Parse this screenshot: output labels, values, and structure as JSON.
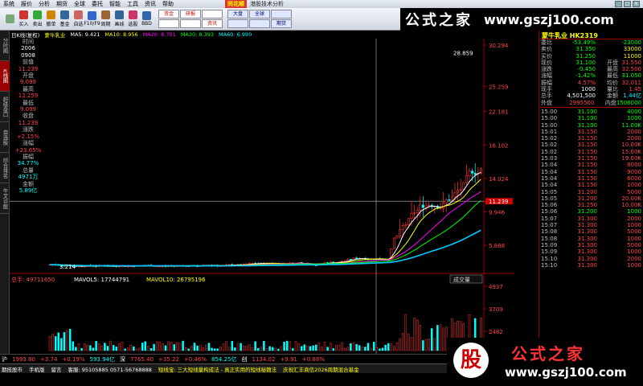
{
  "menu": {
    "items": [
      "系统",
      "报价",
      "分析",
      "期货",
      "全球",
      "委托",
      "智能",
      "工具",
      "资讯",
      "帮助"
    ]
  },
  "app": {
    "logo": "同花顺",
    "title": "港股技术分析"
  },
  "toolbar": {
    "buttons": [
      "",
      "买入",
      "卖出",
      "撤单",
      "基金",
      "自选",
      "F10/F9",
      "周期",
      "画线",
      "选股",
      "BBD"
    ],
    "grp1": [
      "资金",
      "研报",
      "",
      "",
      "",
      "资讯"
    ],
    "grp2": [
      "大盘",
      "全球",
      "",
      "",
      "",
      "期货"
    ]
  },
  "watermark": {
    "cn": "公式之家",
    "url": "www.gszj100.com"
  },
  "left_tabs": [
    "分时图",
    "K线图",
    "超级盘口",
    "自选股",
    "综合排名",
    "牛叉诊股"
  ],
  "chart_header": {
    "period": "日K线(复权)",
    "name": "蒙牛乳业",
    "ma5": "MA5: 9.421",
    "ma10": "MA10: 8.956",
    "ma20": "MA20: 8.701",
    "ma30": "MA30: 8.393",
    "ma60": "MA60: 6.990"
  },
  "info": {
    "time_label": "时间",
    "date_y": "2006",
    "date_md": "0908",
    "prev_label": "前值",
    "prev": "11.239",
    "open_label": "开盘",
    "open": "9.099",
    "high_label": "最高",
    "high": "12.259",
    "low_label": "最低",
    "low": "9.099",
    "close_label": "收盘",
    "close": "11.239",
    "chg_label": "涨跌",
    "chg": "+2.15%",
    "pct_label": "涨幅",
    "pct": "+23.65%",
    "amp_label": "振幅",
    "amp": "34.77%",
    "vol_label": "总量",
    "vol": "4971万",
    "amt_label": "金额",
    "amt": "5.89亿"
  },
  "axis": {
    "prices": [
      "30.294",
      "25.259",
      "22.181",
      "18.102",
      "14.024",
      "11.239",
      "9.946",
      "5.868"
    ],
    "max_mark": "28.859",
    "min_mark": "3.214",
    "vol_ticks": [
      "4937",
      "3709",
      "2482"
    ],
    "vol_sel": "成交量"
  },
  "vol_header": {
    "label": "总手: 49711650",
    "ma5": "MAVOL5: 17744791",
    "ma10": "MAVOL10: 26795196"
  },
  "quote": {
    "title": "蒙牛乳业 HK2319",
    "rows": [
      {
        "l": "委比",
        "m": "-53.49%",
        "r": "",
        "rv": "-23000",
        "mc": "green",
        "rc": "green"
      },
      {
        "l": "卖价",
        "m": "31.350",
        "r": "",
        "rv": "33000",
        "mc": "green",
        "rc": "yel"
      },
      {
        "l": "买价",
        "m": "31.250",
        "r": "",
        "rv": "11000",
        "mc": "green",
        "rc": "yel"
      },
      {
        "l": "现价",
        "m": "31.100",
        "r": "开盘",
        "rv": "31.550",
        "mc": "green",
        "rc": "red"
      },
      {
        "l": "涨跌",
        "m": "-0.450",
        "r": "最高",
        "rv": "32.500",
        "mc": "green",
        "rc": "red"
      },
      {
        "l": "涨幅",
        "m": "-1.42%",
        "r": "最低",
        "rv": "31.050",
        "mc": "green",
        "rc": "green"
      },
      {
        "l": "振幅",
        "m": "4.57%",
        "r": "均价",
        "rv": "32.011",
        "mc": "red",
        "rc": "red"
      },
      {
        "l": "现手",
        "m": "1000",
        "r": "量比",
        "rv": "1.45",
        "mc": "wht",
        "rc": "red"
      },
      {
        "l": "总手",
        "m": "4,501,500",
        "r": "金额",
        "rv": "1.44亿",
        "mc": "wht",
        "rc": "cyan"
      },
      {
        "l": "外盘",
        "m": "2995500",
        "r": "内盘",
        "rv": "1506000",
        "mc": "red",
        "rc": "green"
      }
    ],
    "ticks": [
      {
        "t": "15:00",
        "p": "31.100",
        "v": "4000",
        "c": "green"
      },
      {
        "t": "15:00",
        "p": "31.100",
        "v": "1000",
        "c": "green"
      },
      {
        "t": "15:00",
        "p": "31.100",
        "v": "11.00K",
        "c": "green"
      },
      {
        "t": "15:01",
        "p": "31.150",
        "v": "2000",
        "c": "red"
      },
      {
        "t": "15:02",
        "p": "31.150",
        "v": "2000",
        "c": "red"
      },
      {
        "t": "15:02",
        "p": "31.150",
        "v": "10.00K",
        "c": "red"
      },
      {
        "t": "15:02",
        "p": "31.150",
        "v": "15.00K",
        "c": "red"
      },
      {
        "t": "15:03",
        "p": "31.150",
        "v": "19.00K",
        "c": "red"
      },
      {
        "t": "15:04",
        "p": "31.150",
        "v": "8000",
        "c": "red"
      },
      {
        "t": "15:04",
        "p": "31.150",
        "v": "9000",
        "c": "red"
      },
      {
        "t": "15:04",
        "p": "31.150",
        "v": "6000",
        "c": "red"
      },
      {
        "t": "15:04",
        "p": "31.150",
        "v": "1000",
        "c": "red"
      },
      {
        "t": "15:05",
        "p": "31.200",
        "v": "5000",
        "c": "red"
      },
      {
        "t": "15:05",
        "p": "31.200",
        "v": "20.00K",
        "c": "red"
      },
      {
        "t": "15:06",
        "p": "31.250",
        "v": "10.00K",
        "c": "red"
      },
      {
        "t": "15:06",
        "p": "31.200",
        "v": "1000",
        "c": "green"
      },
      {
        "t": "15:07",
        "p": "31.300",
        "v": "2000",
        "c": "red"
      },
      {
        "t": "15:07",
        "p": "31.300",
        "v": "1000",
        "c": "red"
      },
      {
        "t": "15:08",
        "p": "31.300",
        "v": "5000",
        "c": "red"
      },
      {
        "t": "15:08",
        "p": "31.300",
        "v": "1000",
        "c": "red"
      },
      {
        "t": "15:09",
        "p": "31.300",
        "v": "5000",
        "c": "red"
      },
      {
        "t": "15:09",
        "p": "31.300",
        "v": "1000",
        "c": "red"
      },
      {
        "t": "15:10",
        "p": "31.300",
        "v": "2000",
        "c": "red"
      },
      {
        "t": "15:10",
        "p": "31.300",
        "v": "1000",
        "c": "red"
      }
    ]
  },
  "status": {
    "sh_label": "沪",
    "sh": "1993.80",
    "sh_chg": "+3.74",
    "sh_pct": "+0.19%",
    "sz_amt": "593.94亿",
    "sz_label": "深",
    "sz": "7765.40",
    "sz_chg": "+35.22",
    "sz_pct": "+0.46%",
    "sz_amt2": "854.25亿",
    "cy_label": "创",
    "cy": "1134.02",
    "cy_chg": "+9.91",
    "cy_pct": "+0.88%"
  },
  "bottom": {
    "items": [
      "期技股市",
      "手机版",
      "留言",
      "客服: 95105885 0571-56768888",
      "短线宝: 三大短线量构成法 - 真正实用的短线秘籍法",
      "庆祝汇丰商信2026周期混合基金"
    ]
  },
  "stamp": {
    "gu": "股",
    "n1": "公式之家",
    "n2": "www.gszj100.com"
  },
  "chart_data": {
    "type": "candlestick",
    "title": "蒙牛乳业 日K线(复权)",
    "ylim": [
      3.214,
      30.294
    ],
    "notes": "approximate recreation; price range 3.214–30.294",
    "series_ma": [
      "MA5",
      "MA10",
      "MA20",
      "MA30",
      "MA60"
    ]
  }
}
